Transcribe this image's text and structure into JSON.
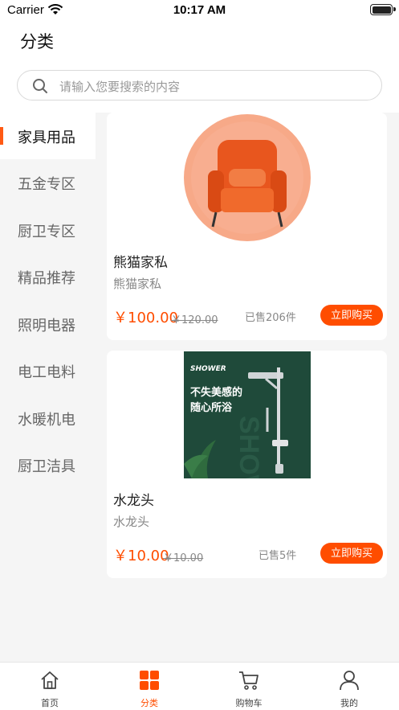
{
  "status_bar": {
    "carrier": "Carrier",
    "time": "10:17 AM"
  },
  "header": {
    "title": "分类"
  },
  "search": {
    "placeholder": "请输入您要搜索的内容"
  },
  "sidebar": {
    "items": [
      {
        "label": "家具用品",
        "active": true
      },
      {
        "label": "五金专区"
      },
      {
        "label": "厨卫专区"
      },
      {
        "label": "精品推荐"
      },
      {
        "label": "照明电器"
      },
      {
        "label": "电工电料"
      },
      {
        "label": "水暖机电"
      },
      {
        "label": "厨卫洁具"
      }
    ]
  },
  "products": [
    {
      "name": "熊猫家私",
      "desc": "熊猫家私",
      "price": "￥100.00",
      "old_price": "￥120.00",
      "sold": "已售206件",
      "buy_label": "立即购买",
      "image": "orange-armchair"
    },
    {
      "name": "水龙头",
      "desc": "水龙头",
      "price": "￥10.00",
      "old_price": "￥10.00",
      "sold": "已售5件",
      "buy_label": "立即购买",
      "image": "shower-set",
      "image_text": {
        "brand": "SHOWER",
        "line1": "不失美感的",
        "line2": "随心所浴"
      }
    }
  ],
  "tabbar": {
    "tabs": [
      {
        "label": "首页",
        "icon": "home-icon"
      },
      {
        "label": "分类",
        "icon": "category-icon",
        "active": true
      },
      {
        "label": "购物车",
        "icon": "cart-icon"
      },
      {
        "label": "我的",
        "icon": "user-icon"
      }
    ]
  },
  "colors": {
    "accent": "#ff4d00",
    "sidebar_bg": "#f5f5f5"
  }
}
